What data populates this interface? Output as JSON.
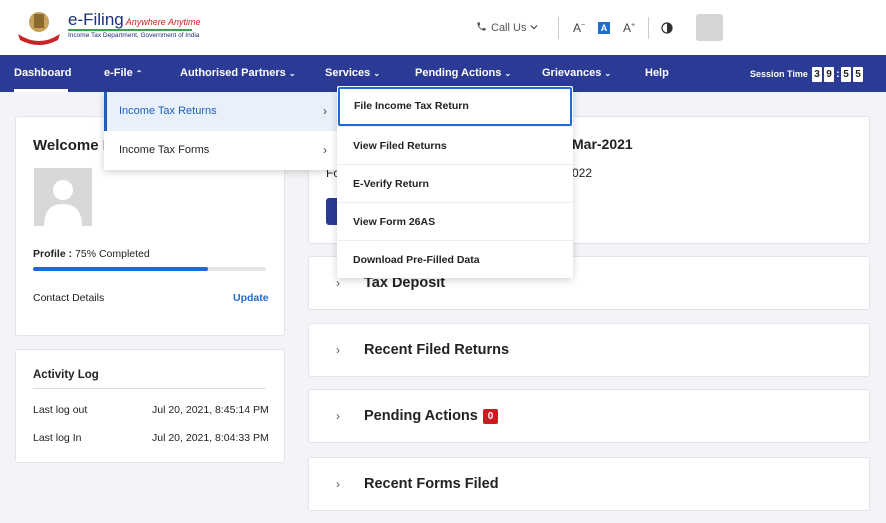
{
  "header": {
    "logo_title": "e-Filing",
    "logo_tagline": "Anywhere Anytime",
    "logo_subtitle": "Income Tax Department, Government of India",
    "call_us": "Call Us",
    "font_decrease": "A",
    "font_default": "A",
    "font_increase": "A",
    "icons": [
      "emblem-logo",
      "phone-icon",
      "chevron-down-icon",
      "contrast-icon",
      "avatar"
    ]
  },
  "nav": {
    "items": [
      "Dashboard",
      "e-File",
      "Authorised Partners",
      "Services",
      "Pending Actions",
      "Grievances",
      "Help"
    ],
    "session_label": "Session Time",
    "session_digits": [
      "3",
      "9",
      "5",
      "5"
    ]
  },
  "efile_menu": {
    "items": [
      {
        "label": "Income Tax Returns",
        "active": true
      },
      {
        "label": "Income Tax Forms",
        "active": false
      }
    ]
  },
  "itr_menu": {
    "items": [
      "File Income Tax Return",
      "View Filed Returns",
      "E-Verify Return",
      "View Form 26AS",
      "Download Pre-Filled Data"
    ]
  },
  "welcome": {
    "title": "Welcome E",
    "profile_label": "Profile :",
    "profile_value": "75% Completed",
    "profile_fraction": 0.75,
    "contact_label": "Contact Details",
    "update_label": "Update"
  },
  "activity": {
    "title": "Activity Log",
    "rows": [
      {
        "label": "Last log out",
        "value": "Jul 20, 2021, 8:45:14 PM"
      },
      {
        "label": "Last log In",
        "value": "Jul 20, 2021, 8:04:33 PM"
      }
    ]
  },
  "main": {
    "partial_title": "Mar-2021",
    "partial_fo": "Fo",
    "partial_year": "022",
    "sections": [
      {
        "title": "Tax Deposit"
      },
      {
        "title": "Recent Filed Returns"
      },
      {
        "title": "Pending Actions",
        "badge": "0"
      },
      {
        "title": "Recent Forms Filed"
      }
    ]
  },
  "colors": {
    "nav_bg": "#2b3b95",
    "accent": "#1f6bd0",
    "badge": "#d2181e"
  }
}
